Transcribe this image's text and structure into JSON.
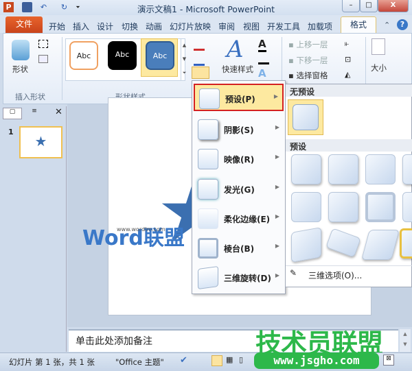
{
  "window": {
    "title": "演示文稿1 - Microsoft PowerPoint",
    "minimize": "–",
    "maximize": "□",
    "close": "X"
  },
  "quick_access": {
    "app": "P",
    "save": "save-icon",
    "undo": "↶",
    "redo": "↻",
    "customize": "⏷"
  },
  "tabs": [
    "文件",
    "开始",
    "插入",
    "设计",
    "切换",
    "动画",
    "幻灯片放映",
    "审阅",
    "视图",
    "开发工具",
    "加载项",
    "格式"
  ],
  "help": "?",
  "ribbon": {
    "insert_shapes": {
      "shapes_label": "形状",
      "group_label": "插入形状"
    },
    "shape_styles": {
      "styles": [
        "Abc",
        "Abc",
        "Abc"
      ],
      "group_label": "形状样式"
    },
    "wordart": {
      "quick_styles": "快速样式"
    },
    "arrange": {
      "bring_forward": "上移一层",
      "send_backward": "下移一层",
      "selection_pane": "选择窗格"
    },
    "size": {
      "label": "大小"
    }
  },
  "effects_menu": {
    "items": [
      {
        "label": "预设(P)",
        "key": "P"
      },
      {
        "label": "阴影(S)"
      },
      {
        "label": "映像(R)"
      },
      {
        "label": "发光(G)"
      },
      {
        "label": "柔化边缘(E)"
      },
      {
        "label": "棱台(B)"
      },
      {
        "label": "三维旋转(D)"
      }
    ]
  },
  "preset_submenu": {
    "no_preset_header": "无预设",
    "preset_header": "预设",
    "options_link": "三维选项(O)..."
  },
  "thumbnail": {
    "number": "1"
  },
  "notes": {
    "placeholder": "单击此处添加备注"
  },
  "status": {
    "slide_info": "幻灯片 第 1 张，共 1 张",
    "theme": "\"Office 主题\""
  },
  "watermarks": {
    "wordlm": "Word联盟",
    "wordlm_url": "www.wordlm.com",
    "jsgho": "技术员联盟",
    "jsgho_url": "www.jsgho.com"
  },
  "colors": {
    "file_tab": "#d9532a",
    "highlight_border": "#d42020",
    "watermark_green": "#2db84a",
    "star": "#3b6fb0"
  }
}
